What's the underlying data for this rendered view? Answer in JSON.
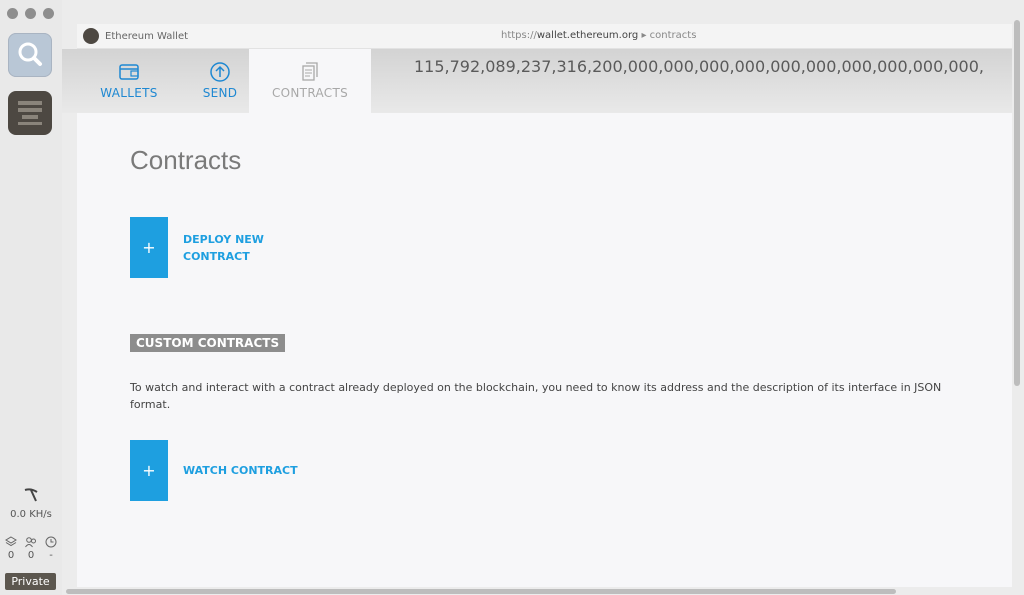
{
  "sidebar": {
    "hashrate": "0.0 KH/s",
    "peers": "0",
    "pending": "0",
    "time": "-",
    "network_badge": "Private"
  },
  "browser": {
    "site_title": "Ethereum Wallet",
    "url_protocol": "https://",
    "url_host": "wallet.ethereum.org",
    "url_path": "contracts"
  },
  "nav": {
    "wallets": "WALLETS",
    "send": "SEND",
    "contracts": "CONTRACTS"
  },
  "balance": "115,792,089,237,316,200,000,000,000,000,000,000,000,000,000,000,",
  "page": {
    "title": "Contracts",
    "deploy_label_line1": "DEPLOY NEW",
    "deploy_label_line2": "CONTRACT",
    "plus": "+",
    "custom_heading": "CUSTOM CONTRACTS",
    "custom_description": "To watch and interact with a contract already deployed on the blockchain, you need to know its address and the description of its interface in JSON format.",
    "watch_label": "WATCH CONTRACT"
  },
  "colors": {
    "accent": "#1e9fe0",
    "nav_active": "#1e88d2",
    "badge_bg": "#5c574f"
  }
}
